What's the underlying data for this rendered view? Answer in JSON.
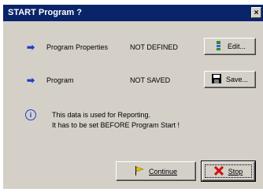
{
  "window": {
    "title": "START Program ?",
    "close_glyph": "×"
  },
  "rows": [
    {
      "arrow_glyph": "➡",
      "label": "Program Properties",
      "status": "NOT DEFINED",
      "button": {
        "label": "Edit...",
        "icon": "properties-icon"
      }
    },
    {
      "arrow_glyph": "➡",
      "label": "Program",
      "status": "NOT SAVED",
      "button": {
        "label": "Save...",
        "icon": "floppy-disk-icon"
      }
    }
  ],
  "info": {
    "icon_glyph": "i",
    "line1": "This data is used for Reporting.",
    "line2": "It has to be set BEFORE Program Start !"
  },
  "footer": {
    "continue": {
      "label": "Continue",
      "icon": "flag-icon"
    },
    "stop": {
      "label": "Stop",
      "icon": "x-icon"
    }
  },
  "colors": {
    "titlebar": "#0a246a",
    "arrow": "#1f3fc8",
    "stop_x": "#d01010",
    "flag": "#e8c000"
  }
}
